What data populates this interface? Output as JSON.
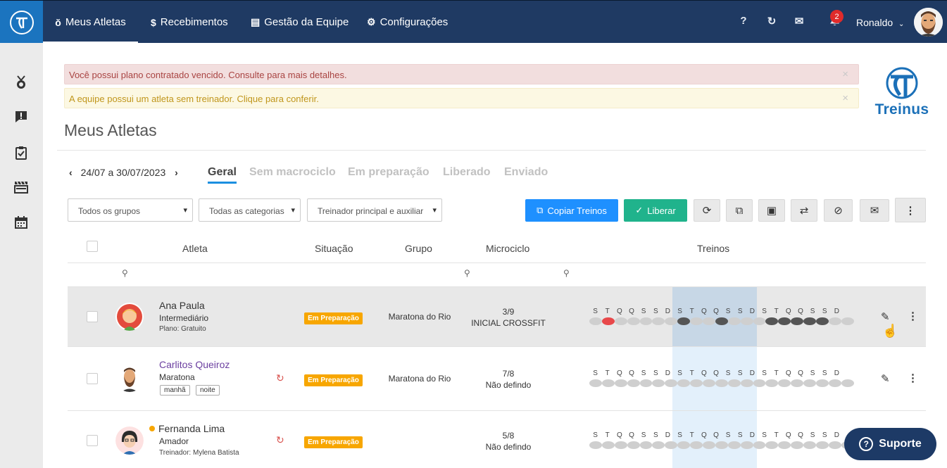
{
  "topbar": {
    "nav": [
      {
        "icon": "medal-icon",
        "glyph": "ŏ",
        "label": "Meus Atletas",
        "active": true
      },
      {
        "icon": "dollar-icon",
        "glyph": "$",
        "label": "Recebimentos"
      },
      {
        "icon": "contact-card-icon",
        "glyph": "▤",
        "label": "Gestão da Equipe"
      },
      {
        "icon": "gears-icon",
        "glyph": "⚙",
        "label": "Configurações"
      }
    ],
    "help": "?",
    "notifications_count": "2",
    "user_name": "Ronaldo"
  },
  "alerts": {
    "plan_expired": "Você possui plano contratado vencido. Consulte para mais detalhes.",
    "no_coach": "A equipe possui um atleta sem treinador. Clique para conferir.",
    "close": "×"
  },
  "brand": {
    "name": "Treinus"
  },
  "page_title": "Meus Atletas",
  "week": {
    "range": "24/07 a 30/07/2023"
  },
  "tabs": [
    "Geral",
    "Sem macrociclo",
    "Em preparação",
    "Liberado",
    "Enviado"
  ],
  "filters": {
    "groups": "Todos os grupos",
    "categories": "Todas as categorias",
    "coach": "Treinador principal e auxiliar"
  },
  "actions": {
    "copy": "Copiar Treinos",
    "release": "Liberar"
  },
  "table": {
    "headers": {
      "athlete": "Atleta",
      "status": "Situação",
      "group": "Grupo",
      "micro": "Microciclo",
      "trainings": "Treinos"
    }
  },
  "day_letters": [
    "S",
    "T",
    "Q",
    "Q",
    "S",
    "S",
    "D",
    "S",
    "T",
    "Q",
    "Q",
    "S",
    "S",
    "D",
    "S",
    "T",
    "Q",
    "Q",
    "S",
    "S",
    "D"
  ],
  "athletes": [
    {
      "name": "Ana Paula",
      "level": "Intermediário",
      "extra": "Plano: Gratuito",
      "status": "Em Preparação",
      "group": "Maratona do Rio",
      "micro_num": "3/9",
      "micro_name": "INICIAL CROSSFIT",
      "dots": [
        "g",
        "r",
        "g",
        "g",
        "g",
        "g",
        "g",
        "d",
        "g",
        "g",
        "d",
        "g",
        "g",
        "g",
        "d",
        "d",
        "d",
        "d",
        "d",
        "g",
        "g"
      ]
    },
    {
      "name": "Carlitos Queiroz",
      "level": "Maratona",
      "tags": [
        "manhã",
        "noite"
      ],
      "status": "Em Preparação",
      "group": "Maratona do Rio",
      "micro_num": "7/8",
      "micro_name": "Não defindo",
      "dots": [
        "g",
        "g",
        "g",
        "g",
        "g",
        "g",
        "g",
        "g",
        "g",
        "g",
        "g",
        "g",
        "g",
        "g",
        "g",
        "g",
        "g",
        "g",
        "g",
        "g",
        "g"
      ]
    },
    {
      "name": "Fernanda Lima",
      "level": "Amador",
      "extra": "Treinador: Mylena Batista",
      "status": "Em Preparação",
      "group": "",
      "micro_num": "5/8",
      "micro_name": "Não defindo",
      "dots": [
        "g",
        "g",
        "g",
        "g",
        "g",
        "g",
        "g",
        "g",
        "g",
        "g",
        "g",
        "g",
        "g",
        "g",
        "g",
        "g",
        "g",
        "g",
        "g",
        "g",
        "g"
      ]
    }
  ],
  "support": "Suporte",
  "colors": {
    "navbar": "#1f3a63",
    "logo_bg": "#1b74bf",
    "accent": "#1e90ff",
    "success": "#20b38c",
    "warning": "#f7a600"
  }
}
